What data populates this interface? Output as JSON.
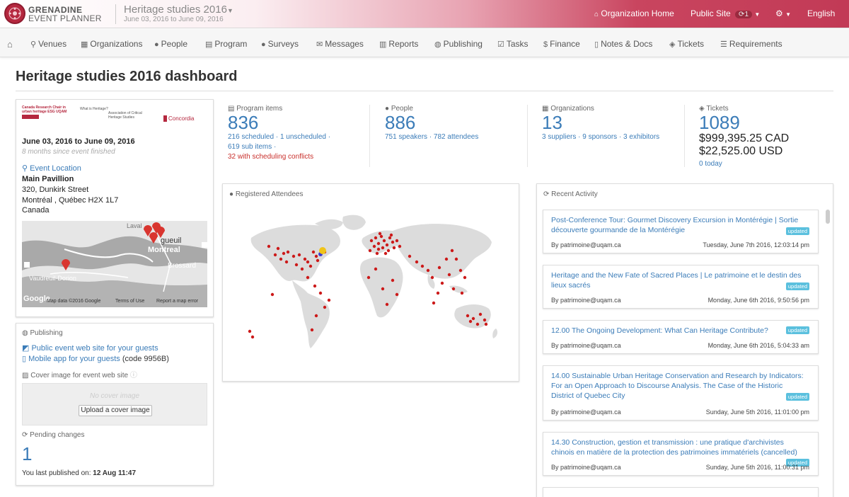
{
  "header": {
    "brand_line1": "GRENADINE",
    "brand_line2": "EVENT PLANNER",
    "event_title": "Heritage studies 2016",
    "event_dates": "June 03, 2016 to June 09, 2016",
    "org_home": "Organization Home",
    "public_site": "Public Site",
    "public_site_count": "1",
    "language": "English"
  },
  "nav": [
    {
      "label": "Venues",
      "icon": "map-marker-icon"
    },
    {
      "label": "Organizations",
      "icon": "building-icon"
    },
    {
      "label": "People",
      "icon": "user-icon"
    },
    {
      "label": "Program",
      "icon": "calendar-icon"
    },
    {
      "label": "Surveys",
      "icon": "comment-icon"
    },
    {
      "label": "Messages",
      "icon": "envelope-icon"
    },
    {
      "label": "Reports",
      "icon": "bar-chart-icon"
    },
    {
      "label": "Publishing",
      "icon": "globe-icon"
    },
    {
      "label": "Tasks",
      "icon": "check-icon"
    },
    {
      "label": "Finance",
      "icon": "dollar-icon"
    },
    {
      "label": "Notes & Docs",
      "icon": "file-icon"
    },
    {
      "label": "Tickets",
      "icon": "tag-icon"
    },
    {
      "label": "Requirements",
      "icon": "list-icon"
    }
  ],
  "page_title": "Heritage studies 2016 dashboard",
  "event_info": {
    "sponsor1": "Canada Research Chair in urban heritage ESG UQAM",
    "sponsor2": "What is Heritage?",
    "sponsor3": "Association of Critical Heritage Studies",
    "sponsor4": "Concordia",
    "dates": "June 03, 2016 to June 09, 2016",
    "since": "8 months since event finished",
    "location_label": "Event Location",
    "venue": "Main Pavillion",
    "street": "320, Dunkirk Street",
    "city": "Montréal , Québec H2X 1L7",
    "country": "Canada",
    "map_labels": {
      "montreal": "Montreal",
      "longueuil": "gueuil",
      "brossard": "Brossard",
      "laval": "Laval",
      "vaudreuil": "Vaudreuil-Dorion",
      "attrib": "Map data ©2016 Google",
      "terms": "Terms of Use",
      "report": "Report a map error",
      "google": "Google"
    }
  },
  "publishing": {
    "heading": "Publishing",
    "public_site_link": "Public event web site for your guests",
    "mobile_link": "Mobile app for your guests",
    "mobile_code": "(code 9956B)",
    "cover_label": "Cover image for event web site",
    "no_cover": "No cover image",
    "upload_btn": "Upload a cover image",
    "pending_label": "Pending changes",
    "pending_count": "1",
    "last_published_prefix": "You last published on:",
    "last_published": "12 Aug 11:47"
  },
  "stats": {
    "program": {
      "label": "Program items",
      "count": "836",
      "line1": "216 scheduled · 1 unscheduled ·",
      "line2": "619 sub items ·",
      "conflicts": "32 with scheduling conflicts"
    },
    "people": {
      "label": "People",
      "count": "886",
      "line1": "751 speakers · 782 attendees"
    },
    "orgs": {
      "label": "Organizations",
      "count": "13",
      "line1": "3 suppliers · 9 sponsors · 3 exhibitors"
    },
    "tickets": {
      "label": "Tickets",
      "count": "1089",
      "cad": "$999,395.25 CAD",
      "usd": "$22,525.00 USD",
      "today": "0 today"
    }
  },
  "attendees_map": {
    "heading": "Registered Attendees"
  },
  "activity": {
    "heading": "Recent Activity",
    "badge": "updated",
    "items": [
      {
        "title": "Post-Conference Tour: Gourmet Discovery Excursion in Montérégie | Sortie découverte gourmande de la Montérégie",
        "by": "By patrimoine@uqam.ca",
        "time": "Tuesday, June 7th 2016, 12:03:14 pm"
      },
      {
        "title": "Heritage and the New Fate of Sacred Places | Le patrimoine et le destin des lieux sacrés",
        "by": "By patrimoine@uqam.ca",
        "time": "Monday, June 6th 2016, 9:50:56 pm"
      },
      {
        "title": "12.00  The Ongoing Development: What Can Heritage Contribute?",
        "by": "By patrimoine@uqam.ca",
        "time": "Monday, June 6th 2016, 5:04:33 am"
      },
      {
        "title": "14.00  Sustainable Urban Heritage Conservation and Research by Indicators: For an Open Approach to Discourse Analysis. The Case of the Historic District of Quebec City",
        "by": "By patrimoine@uqam.ca",
        "time": "Sunday, June 5th 2016, 11:01:00 pm"
      },
      {
        "title": "14.30  Construction, gestion et transmission : une pratique d'archivistes chinois en matière de la protection des patrimoines immatériels (cancelled)",
        "by": "By patrimoine@uqam.ca",
        "time": "Sunday, June 5th 2016, 11:00:31 pm"
      }
    ]
  },
  "colors": {
    "brand": "#b5283f",
    "link": "#3b7cb8",
    "conflict": "#c9302c",
    "badge": "#5bc0de"
  }
}
